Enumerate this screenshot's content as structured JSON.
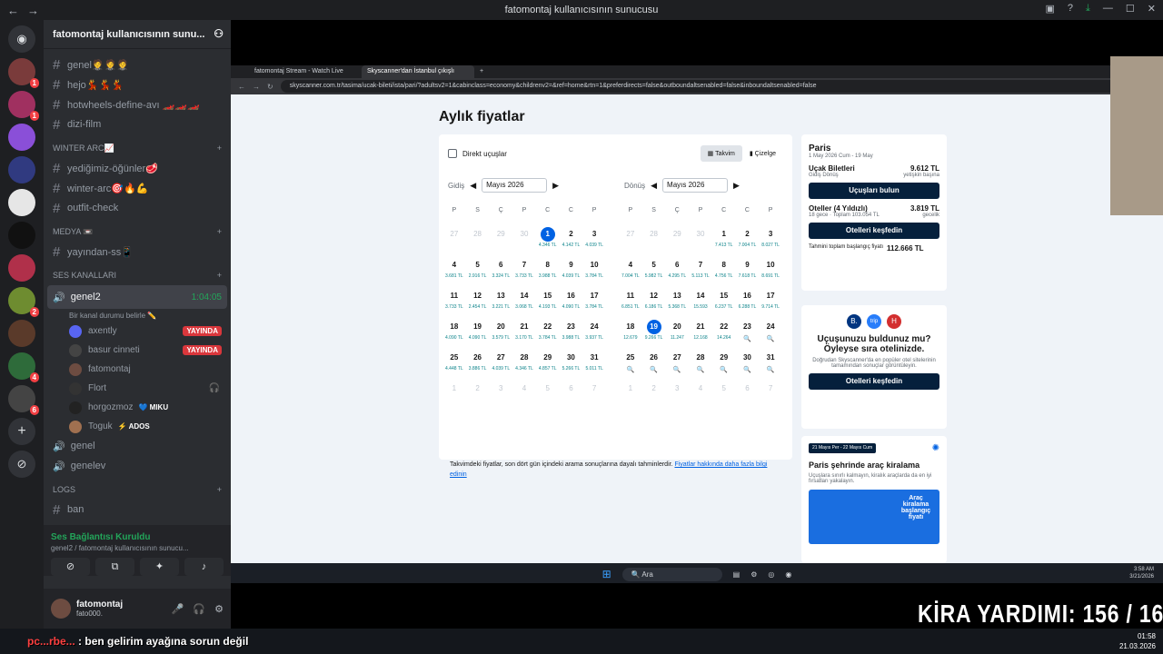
{
  "window": {
    "title": "fatomontaj kullanıcısının sunucusu"
  },
  "server": {
    "name": "fatomontaj kullanıcısının sunu..."
  },
  "text_channels": [
    "genel🤵🤵🤵",
    "hejo💃💃💃",
    "hotwheels-define-avı 🏎️🏎️🏎️",
    "dizi-film"
  ],
  "categories": {
    "winter": "WINTER ARC📈",
    "medya": "MEDYA 📼",
    "ses": "Ses Kanalları",
    "logs": "LOGS"
  },
  "winter_channels": [
    "yediğimiz-öğünler🥩",
    "winter-arc🎯🔥💪",
    "outfit-check"
  ],
  "medya_channels": [
    "yayından-ss📱"
  ],
  "voice": {
    "active_name": "genel2",
    "active_time": "1:04:05",
    "status": "Bir kanal durumu belirle ✏️",
    "users": [
      {
        "name": "axently",
        "live": "YAYINDA"
      },
      {
        "name": "basur cinneti",
        "live": "YAYINDA"
      },
      {
        "name": "fatomontaj",
        "live": ""
      },
      {
        "name": "Flort",
        "live": ""
      },
      {
        "name": "horgozmoz",
        "tag": "💙 MIKU"
      },
      {
        "name": "Toguk",
        "tag": "⚡ ADOS"
      }
    ],
    "others": [
      "genel",
      "genelev"
    ]
  },
  "logs_channels": [
    "ban"
  ],
  "voice_bar": {
    "title": "Ses Bağlantısı Kuruldu",
    "sub": "genel2 / fatomontaj kullanıcısının sunucu..."
  },
  "user_panel": {
    "name": "fatomontaj",
    "tag": "fato000."
  },
  "browser": {
    "tab1": "fatomontaj Stream - Watch Live",
    "tab2": "Skyscanner'dan İstanbul çıkışlı",
    "url": "skyscanner.com.tr/tasima/ucak-bileti/ista/pari/?adultsv2=1&cabinclass=economy&childrenv2=&ref=home&rtn=1&preferdirects=false&outboundaltsenabled=false&inboundaltsenabled=false"
  },
  "sky": {
    "title": "Aylık fiyatlar",
    "direct": "Direkt uçuşlar",
    "takvim": "Takvim",
    "cizelge": "Çizelge",
    "gidis": "Gidiş",
    "donus": "Dönüş",
    "month": "Mayıs 2026",
    "dow": [
      "P",
      "S",
      "Ç",
      "P",
      "C",
      "C",
      "P"
    ],
    "out_days": [
      [
        "27",
        "",
        1
      ],
      [
        "28",
        "",
        1
      ],
      [
        "29",
        "",
        1
      ],
      [
        "30",
        "",
        1
      ],
      [
        "1",
        "4.346 TL",
        2
      ],
      [
        "2",
        "4.142 TL",
        0
      ],
      [
        "3",
        "4.039 TL",
        0
      ],
      [
        "4",
        "3.681 TL",
        0
      ],
      [
        "5",
        "2.916 TL",
        0
      ],
      [
        "6",
        "3.324 TL",
        0
      ],
      [
        "7",
        "3.733 TL",
        0
      ],
      [
        "8",
        "3.988 TL",
        0
      ],
      [
        "9",
        "4.039 TL",
        0
      ],
      [
        "10",
        "3.784 TL",
        0
      ],
      [
        "11",
        "3.733 TL",
        0
      ],
      [
        "12",
        "2.454 TL",
        0
      ],
      [
        "13",
        "3.221 TL",
        0
      ],
      [
        "14",
        "3.068 TL",
        0
      ],
      [
        "15",
        "4.193 TL",
        0
      ],
      [
        "16",
        "4.090 TL",
        0
      ],
      [
        "17",
        "3.784 TL",
        0
      ],
      [
        "18",
        "4.090 TL",
        0
      ],
      [
        "19",
        "4.090 TL",
        0
      ],
      [
        "20",
        "3.579 TL",
        0
      ],
      [
        "21",
        "3.170 TL",
        0
      ],
      [
        "22",
        "3.784 TL",
        0
      ],
      [
        "23",
        "3.988 TL",
        0
      ],
      [
        "24",
        "3.937 TL",
        0
      ],
      [
        "25",
        "4.448 TL",
        0
      ],
      [
        "26",
        "3.886 TL",
        0
      ],
      [
        "27",
        "4.039 TL",
        0
      ],
      [
        "28",
        "4.346 TL",
        0
      ],
      [
        "29",
        "4.857 TL",
        0
      ],
      [
        "30",
        "5.266 TL",
        0
      ],
      [
        "31",
        "5.011 TL",
        0
      ],
      [
        "1",
        "",
        1
      ],
      [
        "2",
        "",
        1
      ],
      [
        "3",
        "",
        1
      ],
      [
        "4",
        "",
        1
      ],
      [
        "5",
        "",
        1
      ],
      [
        "6",
        "",
        1
      ],
      [
        "7",
        "",
        1
      ]
    ],
    "ret_days": [
      [
        "27",
        "",
        1
      ],
      [
        "28",
        "",
        1
      ],
      [
        "29",
        "",
        1
      ],
      [
        "30",
        "",
        1
      ],
      [
        "1",
        "7.413 TL",
        0
      ],
      [
        "2",
        "7.004 TL",
        0
      ],
      [
        "3",
        "8.027 TL",
        0
      ],
      [
        "4",
        "7.004 TL",
        0
      ],
      [
        "5",
        "5.982 TL",
        0
      ],
      [
        "6",
        "4.295 TL",
        0
      ],
      [
        "7",
        "5.113 TL",
        0
      ],
      [
        "8",
        "4.756 TL",
        0
      ],
      [
        "9",
        "7.618 TL",
        0
      ],
      [
        "10",
        "8.691 TL",
        0
      ],
      [
        "11",
        "6.851 TL",
        0
      ],
      [
        "12",
        "6.186 TL",
        0
      ],
      [
        "13",
        "5.368 TL",
        0
      ],
      [
        "14",
        "15.593",
        0
      ],
      [
        "15",
        "6.237 TL",
        0
      ],
      [
        "16",
        "6.288 TL",
        0
      ],
      [
        "17",
        "9.714 TL",
        0
      ],
      [
        "18",
        "12.679",
        0
      ],
      [
        "19",
        "9.266 TL",
        2
      ],
      [
        "20",
        "11.247",
        0
      ],
      [
        "21",
        "12.168",
        0
      ],
      [
        "22",
        "14.264",
        0
      ],
      [
        "23",
        "🔍",
        0
      ],
      [
        "24",
        "🔍",
        0
      ],
      [
        "25",
        "🔍",
        0
      ],
      [
        "26",
        "🔍",
        0
      ],
      [
        "27",
        "🔍",
        0
      ],
      [
        "28",
        "🔍",
        0
      ],
      [
        "29",
        "🔍",
        0
      ],
      [
        "30",
        "🔍",
        0
      ],
      [
        "31",
        "🔍",
        0
      ],
      [
        "1",
        "",
        1
      ],
      [
        "2",
        "",
        1
      ],
      [
        "3",
        "",
        1
      ],
      [
        "4",
        "",
        1
      ],
      [
        "5",
        "",
        1
      ],
      [
        "6",
        "",
        1
      ],
      [
        "7",
        "",
        1
      ]
    ],
    "note": "Takvimdeki fiyatlar, son dört gün içindeki arama sonuçlarına dayalı tahminlerdir.",
    "note_link": "Fiyatlar hakkında daha fazla bilgi edinin",
    "side": {
      "city": "Paris",
      "dates": "1 May 2026 Cum - 19 May",
      "flights": "Uçak Biletleri",
      "flights_price": "9.612 TL",
      "gidis_donus": "Gidiş Dönüş",
      "per": "yetişkin başına",
      "find": "Uçuşları bulun",
      "hotels": "Oteller (4 Yıldızlı)",
      "hotels_price": "3.819 TL",
      "nights": "18 gece · Toplam 103.054 TL",
      "gecelik": "gecelik",
      "explore": "Otelleri keşfedin",
      "total_label": "Tahmini toplam başlangıç fiyatı",
      "total": "112.666 TL"
    },
    "promo": {
      "title": "Uçuşunuzu buldunuz mu? Öyleyse sıra otelinizde.",
      "body": "Doğrudan Skyscanner'da en popüler otel sitelerinin tamamından sonuçlar görüntüleyin.",
      "btn": "Otelleri keşfedin"
    },
    "car": {
      "dates": "21 Mayıs Per - 22 Mayıs Cum",
      "title": "Paris şehrinde araç kiralama",
      "body": "Uçuşlara sınırlı kalmayın, kiralık araçlarda da en iyi fırsatları yakalayın.",
      "img_text": "Araç kiralama başlangıç fiyatı"
    }
  },
  "taskbar": {
    "search": "Ara",
    "time": "3:58 AM",
    "date": "3/21/2026"
  },
  "chat": {
    "user": "pc...rbe...",
    "msg": "ben gelirim ayağına sorun değil"
  },
  "clock": {
    "time": "01:58",
    "date": "21.03.2026"
  },
  "overlay": {
    "kira": "KİRA YARDIMI:  156 / 160"
  }
}
